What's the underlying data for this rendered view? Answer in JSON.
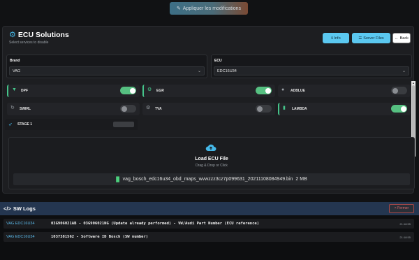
{
  "toolbar": {
    "apply_label": "Appliquer les modifications"
  },
  "header": {
    "title": "ECU Solutions",
    "subtitle": "Select services to disable",
    "info_label": "Info",
    "server_label": "Server Files",
    "back_label": "Back"
  },
  "selects": {
    "brand": {
      "label": "Brand",
      "value": "VAG"
    },
    "ecu": {
      "label": "ECU",
      "value": "EDC16U34"
    }
  },
  "options": [
    {
      "label": "DPF",
      "icon": "filter-icon",
      "on": true,
      "active": true
    },
    {
      "label": "EGR",
      "icon": "egr-icon",
      "on": true,
      "active": true
    },
    {
      "label": "ADBLUE",
      "icon": "droplet-icon",
      "on": false,
      "active": false
    },
    {
      "label": "SWIRL",
      "icon": "swirl-icon",
      "on": false,
      "active": false
    },
    {
      "label": "TVA",
      "icon": "gear-icon",
      "on": false,
      "active": false
    },
    {
      "label": "LAMBDA",
      "icon": "sensor-icon",
      "on": true,
      "active": true
    }
  ],
  "stage": {
    "label": "STAGE 1"
  },
  "upload": {
    "title": "Load ECU File",
    "subtitle": "Drag & Drop or Click",
    "filename": "vag_bosch_edc16u34_obd_maps_wvwzzz3cz7p099631_20211108084949.bin",
    "size": "2 MB"
  },
  "logs": {
    "title": "SW Logs",
    "close_label": "Fermer",
    "rows": [
      {
        "source": "VAG EDC16U34",
        "message": "03G906021AB - 03G906021NG (Update already performed) - VW/Audi Part Number (ECU reference)",
        "time": "21:18:55"
      },
      {
        "source": "VAG EDC16U34",
        "message": "1037381562 - Software ID Bosch (SW number)",
        "time": "21:18:55"
      }
    ]
  },
  "colors": {
    "accent": "#45b8e8",
    "toggle_on": "#56c081",
    "logs_header": "#243650",
    "danger": "#e06a6a"
  }
}
